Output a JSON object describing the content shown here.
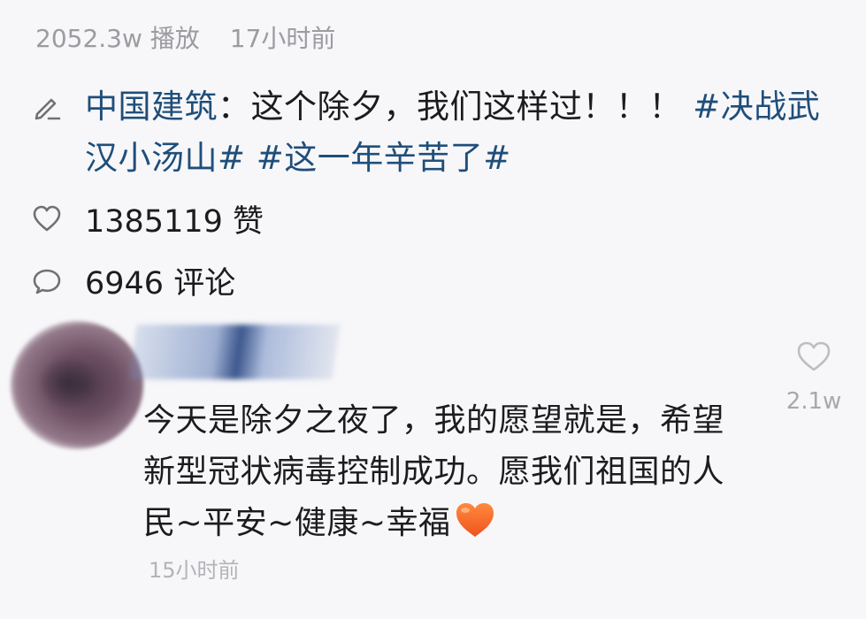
{
  "stats": {
    "plays": "2052.3w 播放",
    "posted": "17小时前"
  },
  "post": {
    "author": "中国建筑",
    "separator": "：",
    "text": "这个除夕，我们这样过！！！",
    "tag1": "#决战武汉小汤山#",
    "tag2": "#这一年辛苦了#"
  },
  "likes": "1385119 赞",
  "comments": "6946 评论",
  "comment": {
    "text": "今天是除夕之夜了，我的愿望就是，希望新型冠状病毒控制成功。愿我们祖国的人民~平安~健康~幸福",
    "time": "15小时前",
    "like_count": "2.1w"
  },
  "icons": {
    "edit": "edit-icon",
    "like": "heart-outline-icon",
    "comment": "comment-bubble-icon",
    "emoji": "orange-heart-emoji"
  },
  "colors": {
    "link": "#1f4e7a",
    "muted": "#9b9ba0",
    "background": "#f7f7f9"
  }
}
